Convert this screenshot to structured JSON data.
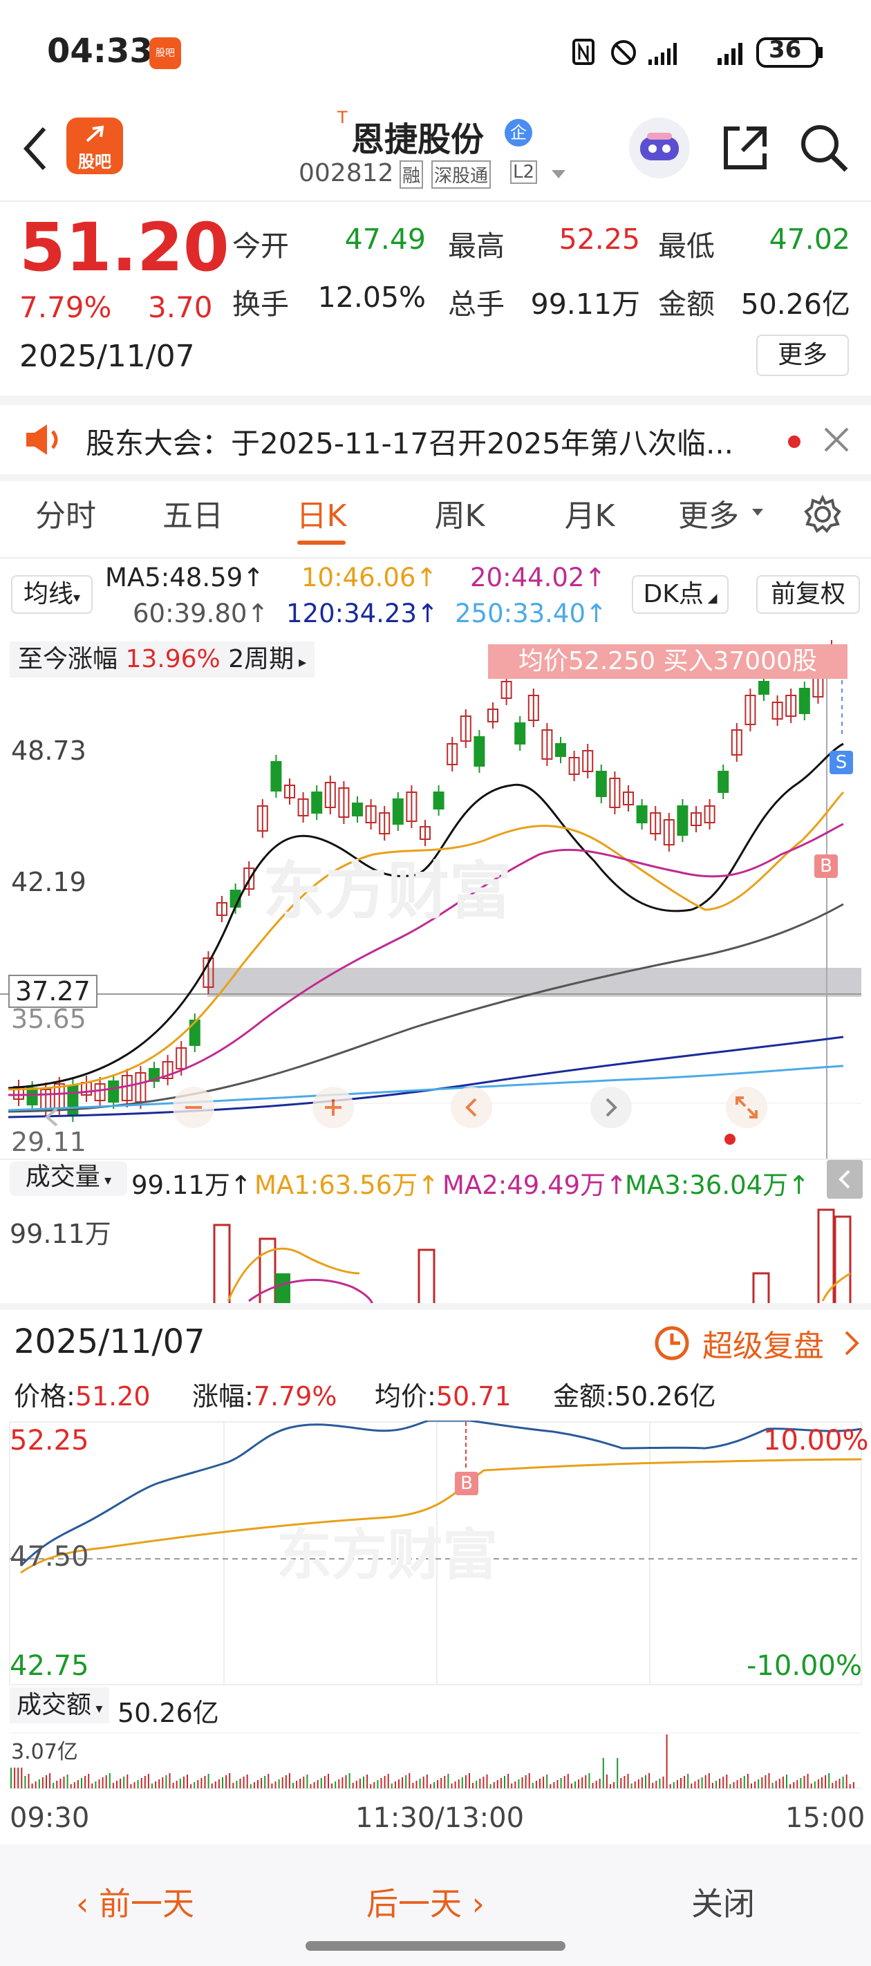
{
  "status": {
    "time": "04:33",
    "app_badge": "股吧",
    "battery": "36"
  },
  "nav": {
    "name": "恩捷股份",
    "name_prefix": "T",
    "badge": "企",
    "code": "002812",
    "tags": [
      "融",
      "深股通",
      "L2"
    ],
    "logo": "股吧"
  },
  "quote": {
    "price": "51.20",
    "pct": "7.79%",
    "chg": "3.70",
    "date": "2025/11/07",
    "f": [
      {
        "l": "今开",
        "v": "47.49",
        "c": "green"
      },
      {
        "l": "最高",
        "v": "52.25",
        "c": "red"
      },
      {
        "l": "最低",
        "v": "47.02",
        "c": "green"
      },
      {
        "l": "换手",
        "v": "12.05%",
        "c": "dark"
      },
      {
        "l": "总手",
        "v": "99.11万",
        "c": "dark"
      },
      {
        "l": "金额",
        "v": "50.26亿",
        "c": "dark"
      }
    ],
    "more": "更多"
  },
  "notice": {
    "text": "股东大会：于2025-11-17召开2025年第八次临..."
  },
  "tabs": [
    "分时",
    "五日",
    "日K",
    "周K",
    "月K",
    "更多"
  ],
  "ma": {
    "btn": "均线",
    "ma5": "MA5:48.59↑",
    "ma10": "10:46.06↑",
    "ma20": "20:44.02↑",
    "ma60": "60:39.80↑",
    "ma120": "120:34.23↑",
    "ma250": "250:33.40↑",
    "dk": "DK点",
    "fq": "前复权"
  },
  "kline": {
    "range_label": "至今涨幅",
    "range_val": "13.96%",
    "period": "2周期",
    "tip": "均价52.250  买入37000股",
    "y1": "48.73",
    "y2": "42.19",
    "y3": "37.27",
    "y4": "35.65",
    "y5": "29.11",
    "mark_s": "S",
    "mark_b": "B",
    "watermark": "东方财富"
  },
  "vol": {
    "btn": "成交量",
    "v": "99.11万↑",
    "ma1": "MA1:63.56万↑",
    "ma2": "MA2:49.49万↑",
    "ma3": "MA3:36.04万↑",
    "top": "99.11万"
  },
  "panel": {
    "date": "2025/11/07",
    "replay": "超级复盘",
    "price_l": "价格:",
    "price": "51.20",
    "pct_l": "涨幅:",
    "pct": "7.79%",
    "avg_l": "均价:",
    "avg": "50.71",
    "amt_l": "金额:",
    "amt": "50.26亿",
    "hi": "52.25",
    "mid": "47.50",
    "lo": "42.75",
    "hip": "10.00%",
    "lop": "-10.00%",
    "mark_b": "B",
    "amt_btn": "成交额",
    "amt_v": "50.26亿",
    "amt_top": "3.07亿",
    "t1": "09:30",
    "t2": "11:30/13:00",
    "t3": "15:00",
    "watermark": "东方财富"
  },
  "bottom": {
    "prev": "前一天",
    "next": "后一天",
    "close": "关闭"
  }
}
